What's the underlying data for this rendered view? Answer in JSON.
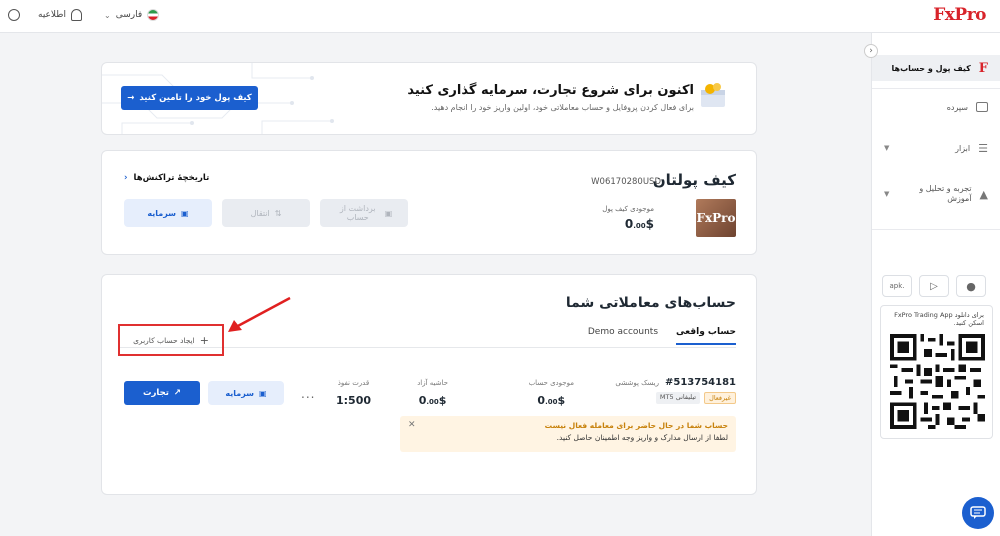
{
  "brand": {
    "logo": "FxPro",
    "accent": "#d8232a",
    "primary": "#1b5fcf"
  },
  "topbar": {
    "language": "فارسی",
    "notifications": "اطلاعیه"
  },
  "sidebar": {
    "items": [
      {
        "label": "کیف پول و حساب‌ها",
        "icon": "fxpro-f-icon"
      },
      {
        "label": "سپرده",
        "icon": "deposit-icon"
      },
      {
        "label": "ابزار",
        "icon": "sliders-icon"
      },
      {
        "label": "تجربه و تحلیل و آموزش",
        "icon": "graduation-cap-icon"
      }
    ],
    "apk_label": "apk.",
    "qr_text": "برای دانلود FxPro Trading App اسکن کنید."
  },
  "banner": {
    "title": "اکنون برای شروع تجارت، سرمایه گذاری کنید",
    "subtitle": "برای فعال کردن پروفایل و حساب معاملاتی خود، اولین واریز خود را انجام دهید.",
    "button": "کیف پول خود را تامین کنید"
  },
  "wallet": {
    "title": "کیف پولتان",
    "id": "W06170280USD",
    "logo_text": "FxPro",
    "balance_label": "موجودی کیف پول",
    "balance_int": "0",
    "balance_dec": ".00",
    "currency": "$",
    "history_link": "تاریخچهٔ تراکنش‌ها",
    "withdraw": "برداشت از حساب",
    "transfer": "انتقال",
    "fund": "سرمایه"
  },
  "accounts": {
    "title": "حساب‌های معاملاتی شما",
    "tabs": [
      "حساب واقعی",
      "Demo accounts"
    ],
    "create": "ایجاد حساب کاربری",
    "account": {
      "number": "#513754181",
      "type": "ریسک پوششی",
      "status_badge": "غیرفعال",
      "platform_badge": "تیلیفانی MT5",
      "balance_label": "موجودی حساب",
      "balance_int": "0",
      "balance_dec": ".00",
      "free_margin_label": "حاشیه آزاد",
      "free_margin_int": "0",
      "free_margin_dec": ".00",
      "currency": "$",
      "leverage_label": "قدرت نفوذ",
      "leverage": "1:500",
      "more": "...",
      "fund_button": "سرمایه",
      "trade_button": "تجارت"
    },
    "notice": {
      "title": "حساب شما در حال حاضر برای معامله فعال نیست",
      "body": "لطفا از ارسال مدارک و واریز وجه اطمینان حاصل کنید."
    }
  }
}
